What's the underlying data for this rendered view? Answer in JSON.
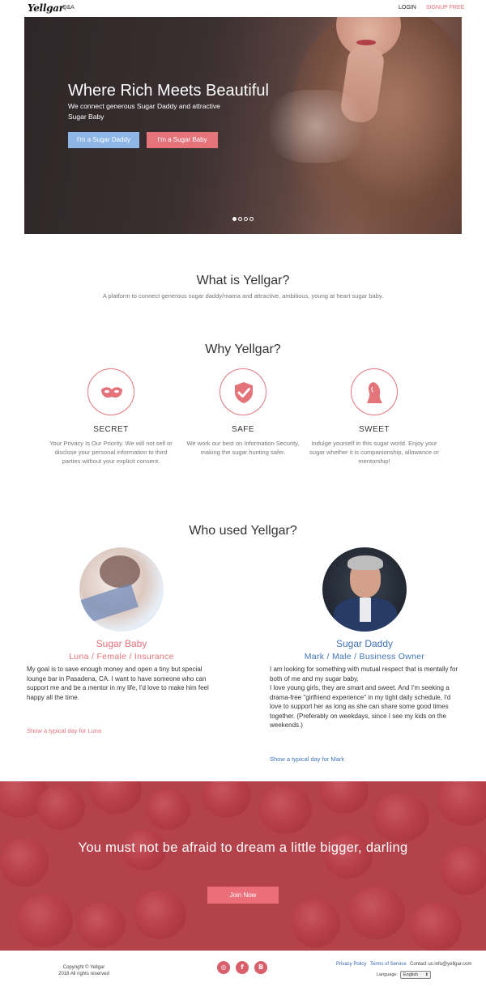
{
  "nav": {
    "logo": "Yellgar",
    "qa": "Q&A",
    "login": "LOGIN",
    "signup": "SIGNUP FREE"
  },
  "hero": {
    "title": "Where Rich Meets Beautiful",
    "subtitle": "We connect generous Sugar Daddy and attractive Sugar Baby",
    "btn_daddy": "I'm a Sugar Daddy",
    "btn_baby": "I'm a Sugar Baby",
    "slides": 4,
    "active_slide": 1
  },
  "about": {
    "title": "What is Yellgar?",
    "text": "A platform to connect generous sugar daddy/mama and attractive, ambitious, young at heart sugar baby."
  },
  "why": {
    "title": "Why Yellgar?",
    "features": [
      {
        "icon": "mask-icon",
        "title": "SECRET",
        "text": "Your Privacy Is Our Priority. We will not sell or disclose your personal information to third parties without your explicit consent."
      },
      {
        "icon": "shield-check-icon",
        "title": "SAFE",
        "text": "We work our best on Information Security, making the sugar hunting safer."
      },
      {
        "icon": "woman-silhouette-icon",
        "title": "SWEET",
        "text": "Indulge yourself in this sugar world. Enjoy your sugar whether it is companionship, allowance or mentorship!"
      }
    ]
  },
  "who": {
    "title": "Who used Yellgar?",
    "baby": {
      "role": "Sugar Baby",
      "info": "Luna / Female / Insurance",
      "text": "My goal is to save enough money and open a tiny but special lounge bar in Pasadena, CA. I want to have someone who can support me and be a mentor in my life, I'd love to make him feel happy all the time.",
      "link": "Show a typical day for Luna"
    },
    "daddy": {
      "role": "Sugar Daddy",
      "info": "Mark / Male / Business Owner",
      "text": "I am looking for something with mutual respect that is mentally for both of me and my sugar baby.\nI love young girls, they are smart and sweet. And I'm seeking a drama-free \"girlfriend experience\" in my tight daily schedule, I'd love to support her as long as she can share some good times together. (Preferably on weekdays, since I see my kids on the weekends.)",
      "link": "Show a typical day for Mark"
    }
  },
  "banner": {
    "text": "You must not be afraid to dream a little bigger, darling",
    "button": "Join Now"
  },
  "footer": {
    "copyright_line1": "Copyright © Yellgar",
    "copyright_line2": "2018 All rights reserved",
    "social": [
      {
        "icon": "instagram-icon",
        "glyph": "◎"
      },
      {
        "icon": "facebook-icon",
        "glyph": "f"
      },
      {
        "icon": "blog-icon",
        "glyph": "B"
      }
    ],
    "privacy": "Privacy Policy",
    "terms": "Terms of Service",
    "contact": "Contact us:info@yellgar.com",
    "language_label": "Language:",
    "language_value": "English"
  },
  "colors": {
    "accent_pink": "#e4737a",
    "accent_blue": "#3f74b8",
    "daddy_button": "#8db5e6"
  }
}
